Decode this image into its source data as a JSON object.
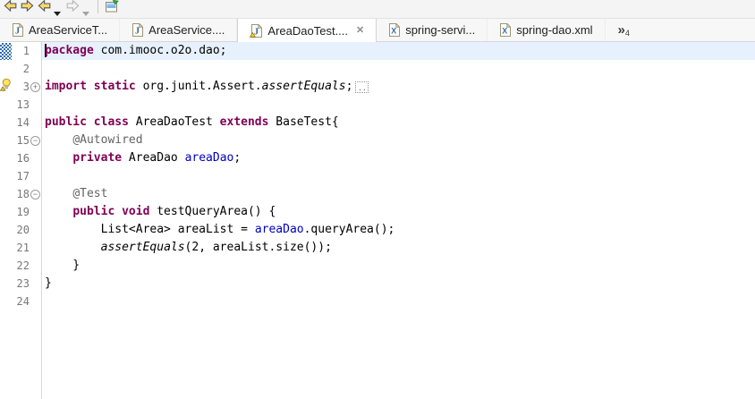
{
  "colors": {
    "keyword": "#7F0055",
    "field_reference": "#0000C0",
    "annotation": "#646464",
    "code_text": "#000000",
    "line_number": "#787878",
    "current_line_highlight": "#E7F1FD",
    "tab_active_bg": "#FFFFFF",
    "range_indicator_blue": "#2F6CB4",
    "warning_yellow": "#FFD23E",
    "nav_arrow_yellow": "#FFD964"
  },
  "toolbar": {
    "items": [
      {
        "name": "nav-back-button",
        "icon": "arrow-left-yellow"
      },
      {
        "name": "nav-forward-button",
        "icon": "arrow-right-yellow"
      },
      {
        "name": "back-history-button",
        "icon": "arrow-left-yellow",
        "menu": "enabled"
      },
      {
        "name": "forward-history-button",
        "icon": "arrow-right-gray",
        "menu": "disabled"
      },
      {
        "name": "toolbar-separator",
        "icon": "separator"
      },
      {
        "name": "editor-window-button",
        "icon": "editor-window"
      }
    ]
  },
  "tab_bar": {
    "close_glyph": "✕",
    "overflow_chevron": "»",
    "overflow_count": "4",
    "tabs": [
      {
        "label": "AreaServiceT...",
        "icon": "java-file",
        "active": false,
        "closable": false
      },
      {
        "label": "AreaService....",
        "icon": "java-file",
        "active": false,
        "closable": false
      },
      {
        "label": "AreaDaoTest....",
        "icon": "java-file-warning",
        "active": true,
        "closable": true
      },
      {
        "label": "spring-servi...",
        "icon": "xml-file",
        "active": false,
        "closable": false
      },
      {
        "label": "spring-dao.xml",
        "icon": "xml-file",
        "active": false,
        "closable": false
      }
    ]
  },
  "editor": {
    "lines": [
      {
        "num": "1",
        "marker": "range-indicator",
        "fold": "",
        "cursor": true,
        "current": true,
        "tokens": [
          [
            "kw",
            "package"
          ],
          [
            "pl",
            " com.imooc.o2o.dao;"
          ]
        ]
      },
      {
        "num": "2",
        "marker": "",
        "fold": "",
        "tokens": []
      },
      {
        "num": "3",
        "marker": "warning-bulb",
        "fold": "plus",
        "tokens": [
          [
            "kw",
            "import static"
          ],
          [
            "pl",
            " org.junit.Assert."
          ],
          [
            "static",
            "assertEquals"
          ],
          [
            "pl",
            ";"
          ],
          [
            "foldbox",
            ".."
          ]
        ]
      },
      {
        "num": "13",
        "marker": "",
        "fold": "",
        "tokens": []
      },
      {
        "num": "14",
        "marker": "",
        "fold": "",
        "tokens": [
          [
            "kw",
            "public class"
          ],
          [
            "pl",
            " AreaDaoTest "
          ],
          [
            "kw",
            "extends"
          ],
          [
            "pl",
            " BaseTest{"
          ]
        ]
      },
      {
        "num": "15",
        "marker": "",
        "fold": "minus",
        "tokens": [
          [
            "pl",
            "    "
          ],
          [
            "ann",
            "@Autowired"
          ]
        ]
      },
      {
        "num": "16",
        "marker": "",
        "fold": "",
        "tokens": [
          [
            "pl",
            "    "
          ],
          [
            "kw",
            "private"
          ],
          [
            "pl",
            " AreaDao "
          ],
          [
            "field",
            "areaDao"
          ],
          [
            "pl",
            ";"
          ]
        ]
      },
      {
        "num": "17",
        "marker": "",
        "fold": "",
        "tokens": []
      },
      {
        "num": "18",
        "marker": "",
        "fold": "minus",
        "tokens": [
          [
            "pl",
            "    "
          ],
          [
            "ann",
            "@Test"
          ]
        ]
      },
      {
        "num": "19",
        "marker": "",
        "fold": "",
        "tokens": [
          [
            "pl",
            "    "
          ],
          [
            "kw",
            "public void"
          ],
          [
            "pl",
            " testQueryArea() {"
          ]
        ]
      },
      {
        "num": "20",
        "marker": "",
        "fold": "",
        "tokens": [
          [
            "pl",
            "        List<Area> areaList = "
          ],
          [
            "field",
            "areaDao"
          ],
          [
            "pl",
            ".queryArea();"
          ]
        ]
      },
      {
        "num": "21",
        "marker": "",
        "fold": "",
        "tokens": [
          [
            "pl",
            "        "
          ],
          [
            "static",
            "assertEquals"
          ],
          [
            "pl",
            "(2, areaList.size());"
          ]
        ]
      },
      {
        "num": "22",
        "marker": "",
        "fold": "",
        "tokens": [
          [
            "pl",
            "    }"
          ]
        ]
      },
      {
        "num": "23",
        "marker": "",
        "fold": "",
        "tokens": [
          [
            "pl",
            "}"
          ]
        ]
      },
      {
        "num": "24",
        "marker": "",
        "fold": "",
        "tokens": []
      }
    ]
  }
}
